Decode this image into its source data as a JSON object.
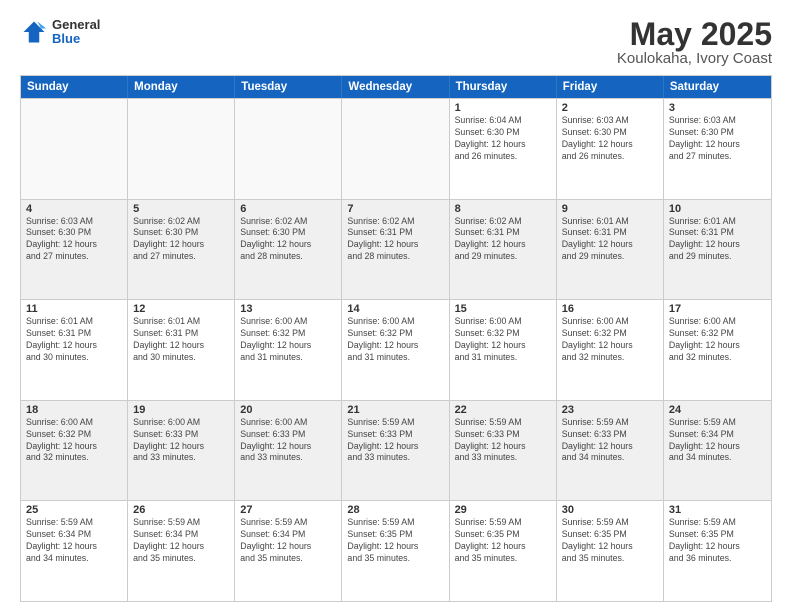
{
  "logo": {
    "general": "General",
    "blue": "Blue"
  },
  "title": "May 2025",
  "subtitle": "Koulokaha, Ivory Coast",
  "days_of_week": [
    "Sunday",
    "Monday",
    "Tuesday",
    "Wednesday",
    "Thursday",
    "Friday",
    "Saturday"
  ],
  "weeks": [
    [
      {
        "day": "",
        "info": "",
        "empty": true
      },
      {
        "day": "",
        "info": "",
        "empty": true
      },
      {
        "day": "",
        "info": "",
        "empty": true
      },
      {
        "day": "",
        "info": "",
        "empty": true
      },
      {
        "day": "1",
        "info": "Sunrise: 6:04 AM\nSunset: 6:30 PM\nDaylight: 12 hours\nand 26 minutes."
      },
      {
        "day": "2",
        "info": "Sunrise: 6:03 AM\nSunset: 6:30 PM\nDaylight: 12 hours\nand 26 minutes."
      },
      {
        "day": "3",
        "info": "Sunrise: 6:03 AM\nSunset: 6:30 PM\nDaylight: 12 hours\nand 27 minutes."
      }
    ],
    [
      {
        "day": "4",
        "info": "Sunrise: 6:03 AM\nSunset: 6:30 PM\nDaylight: 12 hours\nand 27 minutes."
      },
      {
        "day": "5",
        "info": "Sunrise: 6:02 AM\nSunset: 6:30 PM\nDaylight: 12 hours\nand 27 minutes."
      },
      {
        "day": "6",
        "info": "Sunrise: 6:02 AM\nSunset: 6:30 PM\nDaylight: 12 hours\nand 28 minutes."
      },
      {
        "day": "7",
        "info": "Sunrise: 6:02 AM\nSunset: 6:31 PM\nDaylight: 12 hours\nand 28 minutes."
      },
      {
        "day": "8",
        "info": "Sunrise: 6:02 AM\nSunset: 6:31 PM\nDaylight: 12 hours\nand 29 minutes."
      },
      {
        "day": "9",
        "info": "Sunrise: 6:01 AM\nSunset: 6:31 PM\nDaylight: 12 hours\nand 29 minutes."
      },
      {
        "day": "10",
        "info": "Sunrise: 6:01 AM\nSunset: 6:31 PM\nDaylight: 12 hours\nand 29 minutes."
      }
    ],
    [
      {
        "day": "11",
        "info": "Sunrise: 6:01 AM\nSunset: 6:31 PM\nDaylight: 12 hours\nand 30 minutes."
      },
      {
        "day": "12",
        "info": "Sunrise: 6:01 AM\nSunset: 6:31 PM\nDaylight: 12 hours\nand 30 minutes."
      },
      {
        "day": "13",
        "info": "Sunrise: 6:00 AM\nSunset: 6:32 PM\nDaylight: 12 hours\nand 31 minutes."
      },
      {
        "day": "14",
        "info": "Sunrise: 6:00 AM\nSunset: 6:32 PM\nDaylight: 12 hours\nand 31 minutes."
      },
      {
        "day": "15",
        "info": "Sunrise: 6:00 AM\nSunset: 6:32 PM\nDaylight: 12 hours\nand 31 minutes."
      },
      {
        "day": "16",
        "info": "Sunrise: 6:00 AM\nSunset: 6:32 PM\nDaylight: 12 hours\nand 32 minutes."
      },
      {
        "day": "17",
        "info": "Sunrise: 6:00 AM\nSunset: 6:32 PM\nDaylight: 12 hours\nand 32 minutes."
      }
    ],
    [
      {
        "day": "18",
        "info": "Sunrise: 6:00 AM\nSunset: 6:32 PM\nDaylight: 12 hours\nand 32 minutes."
      },
      {
        "day": "19",
        "info": "Sunrise: 6:00 AM\nSunset: 6:33 PM\nDaylight: 12 hours\nand 33 minutes."
      },
      {
        "day": "20",
        "info": "Sunrise: 6:00 AM\nSunset: 6:33 PM\nDaylight: 12 hours\nand 33 minutes."
      },
      {
        "day": "21",
        "info": "Sunrise: 5:59 AM\nSunset: 6:33 PM\nDaylight: 12 hours\nand 33 minutes."
      },
      {
        "day": "22",
        "info": "Sunrise: 5:59 AM\nSunset: 6:33 PM\nDaylight: 12 hours\nand 33 minutes."
      },
      {
        "day": "23",
        "info": "Sunrise: 5:59 AM\nSunset: 6:33 PM\nDaylight: 12 hours\nand 34 minutes."
      },
      {
        "day": "24",
        "info": "Sunrise: 5:59 AM\nSunset: 6:34 PM\nDaylight: 12 hours\nand 34 minutes."
      }
    ],
    [
      {
        "day": "25",
        "info": "Sunrise: 5:59 AM\nSunset: 6:34 PM\nDaylight: 12 hours\nand 34 minutes."
      },
      {
        "day": "26",
        "info": "Sunrise: 5:59 AM\nSunset: 6:34 PM\nDaylight: 12 hours\nand 35 minutes."
      },
      {
        "day": "27",
        "info": "Sunrise: 5:59 AM\nSunset: 6:34 PM\nDaylight: 12 hours\nand 35 minutes."
      },
      {
        "day": "28",
        "info": "Sunrise: 5:59 AM\nSunset: 6:35 PM\nDaylight: 12 hours\nand 35 minutes."
      },
      {
        "day": "29",
        "info": "Sunrise: 5:59 AM\nSunset: 6:35 PM\nDaylight: 12 hours\nand 35 minutes."
      },
      {
        "day": "30",
        "info": "Sunrise: 5:59 AM\nSunset: 6:35 PM\nDaylight: 12 hours\nand 35 minutes."
      },
      {
        "day": "31",
        "info": "Sunrise: 5:59 AM\nSunset: 6:35 PM\nDaylight: 12 hours\nand 36 minutes."
      }
    ]
  ]
}
